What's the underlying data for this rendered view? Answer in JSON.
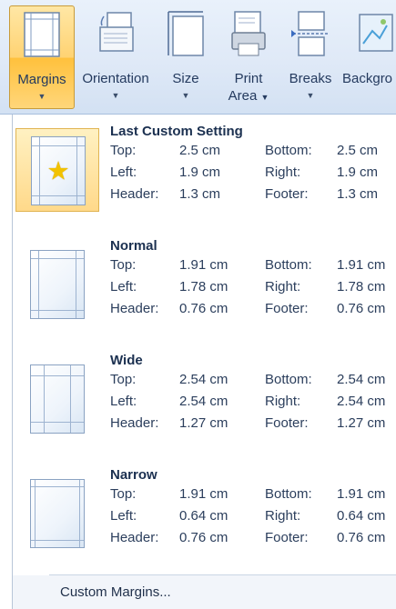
{
  "ribbon": {
    "margins": "Margins",
    "orientation": "Orientation",
    "size": "Size",
    "print_area_line1": "Print",
    "print_area_line2": "Area",
    "breaks": "Breaks",
    "background": "Backgro"
  },
  "menu": {
    "options": [
      {
        "name": "Last Custom Setting",
        "top_label": "Top:",
        "top": "2.5 cm",
        "bottom_label": "Bottom:",
        "bottom": "2.5 cm",
        "left_label": "Left:",
        "left": "1.9 cm",
        "right_label": "Right:",
        "right": "1.9 cm",
        "header_label": "Header:",
        "header": "1.3 cm",
        "footer_label": "Footer:",
        "footer": "1.3 cm"
      },
      {
        "name": "Normal",
        "top_label": "Top:",
        "top": "1.91 cm",
        "bottom_label": "Bottom:",
        "bottom": "1.91 cm",
        "left_label": "Left:",
        "left": "1.78 cm",
        "right_label": "Right:",
        "right": "1.78 cm",
        "header_label": "Header:",
        "header": "0.76 cm",
        "footer_label": "Footer:",
        "footer": "0.76 cm"
      },
      {
        "name": "Wide",
        "top_label": "Top:",
        "top": "2.54 cm",
        "bottom_label": "Bottom:",
        "bottom": "2.54 cm",
        "left_label": "Left:",
        "left": "2.54 cm",
        "right_label": "Right:",
        "right": "2.54 cm",
        "header_label": "Header:",
        "header": "1.27 cm",
        "footer_label": "Footer:",
        "footer": "1.27 cm"
      },
      {
        "name": "Narrow",
        "top_label": "Top:",
        "top": "1.91 cm",
        "bottom_label": "Bottom:",
        "bottom": "1.91 cm",
        "left_label": "Left:",
        "left": "0.64 cm",
        "right_label": "Right:",
        "right": "0.64 cm",
        "header_label": "Header:",
        "header": "0.76 cm",
        "footer_label": "Footer:",
        "footer": "0.76 cm"
      }
    ],
    "custom_margins": "Custom Margins..."
  },
  "colors": {
    "accent_active": "#ffd373",
    "ribbon_bg": "#dfe9f7",
    "text": "#1f2f4a"
  }
}
